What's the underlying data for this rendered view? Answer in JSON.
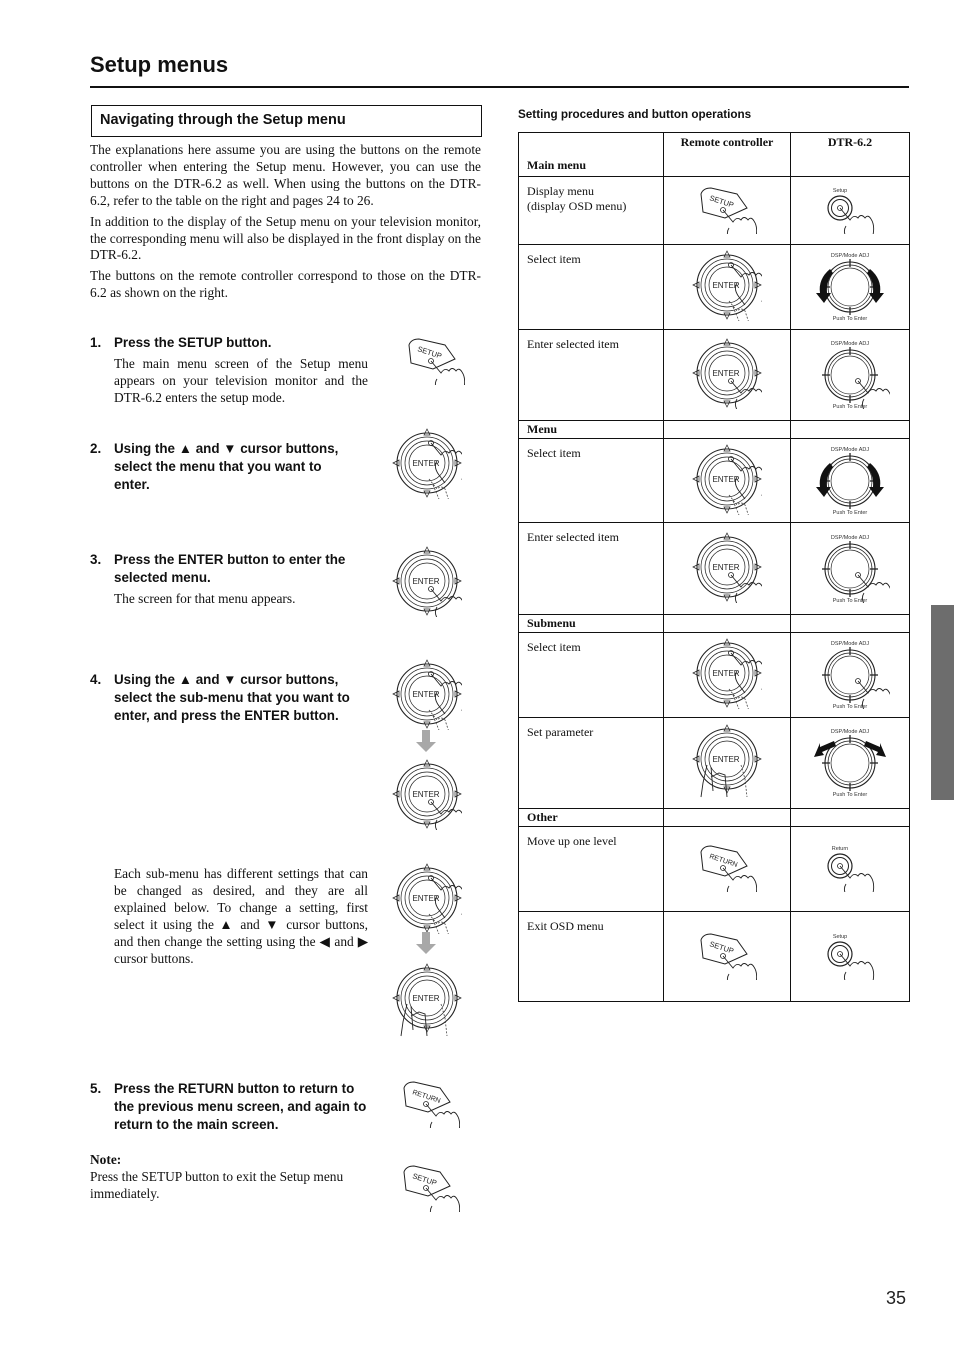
{
  "page": {
    "title": "Setup menus",
    "page_number": "35",
    "side_tab_color": "#6d6d6d"
  },
  "section": {
    "heading": "Navigating through the Setup menu",
    "intro": [
      "The explanations here assume you are using the buttons on the remote controller when entering the Setup menu. However, you can use the buttons on the DTR-6.2 as well. When using the buttons on the DTR-6.2, refer to the table on the right and pages 24 to 26.",
      "In addition to the display of the Setup menu on your television monitor, the corresponding menu will also be displayed in the front display on the DTR-6.2.",
      "The buttons on the remote controller correspond to those on the DTR-6.2 as shown on the right."
    ]
  },
  "steps": [
    {
      "num": "1.",
      "heading": "Press the SETUP button.",
      "body": "The main menu screen of the Setup menu appears on your television monitor and the DTR-6.2 enters the setup mode.",
      "icon": "setup-button-press"
    },
    {
      "num": "2.",
      "heading": "Using the ▲ and ▼ cursor buttons, select the menu that you want to enter.",
      "body": "",
      "icon": "enter-dial-up-down"
    },
    {
      "num": "3.",
      "heading": "Press the ENTER button to enter the selected menu.",
      "body": "The screen for that menu appears.",
      "icon": "enter-dial-press"
    },
    {
      "num": "4.",
      "heading": "Using the ▲ and ▼ cursor buttons, select the sub-menu that you want to enter, and press the ENTER button.",
      "body": "",
      "icon": "enter-dial-up-down-then-press"
    },
    {
      "num": "",
      "heading": "",
      "body": "Each sub-menu has different settings that can be changed as desired, and they are all explained below. To change a setting, first select it using the ▲ and ▼ cursor buttons, and then change the setting using the ◀ and ▶ cursor buttons.",
      "icon": "enter-dial-up-down-then-left-right"
    },
    {
      "num": "5.",
      "heading": "Press the RETURN button to return to the previous menu screen, and again to return to the main screen.",
      "body": "",
      "icon": "return-button-press"
    }
  ],
  "note": {
    "label": "Note:",
    "text": "Press the SETUP button to exit the Setup menu immediately.",
    "icon": "setup-button-press"
  },
  "table": {
    "title": "Setting procedures and button operations",
    "headers": {
      "col1": "Main menu",
      "col2": "Remote controller",
      "col3": "DTR-6.2"
    },
    "sections": [
      {
        "name": "Main menu",
        "rows": [
          {
            "label": "Display menu\n (display OSD menu)",
            "remote": "SETUP",
            "unit": "Setup"
          },
          {
            "label": "Select item",
            "remote": "ENTER",
            "unit": "DSP/Mode ADJ",
            "unit_bottom": "Push To Enter"
          },
          {
            "label": "Enter selected item",
            "remote": "ENTER",
            "unit": "DSP/Mode ADJ",
            "unit_bottom": "Push To Enter"
          }
        ]
      },
      {
        "name": "Menu",
        "rows": [
          {
            "label": "Select item",
            "remote": "ENTER",
            "unit": "DSP/Mode ADJ",
            "unit_bottom": "Push To Enter"
          },
          {
            "label": "Enter selected item",
            "remote": "ENTER",
            "unit": "DSP/Mode ADJ",
            "unit_bottom": "Push To Enter"
          }
        ]
      },
      {
        "name": "Submenu",
        "rows": [
          {
            "label": "Select item",
            "remote": "ENTER",
            "unit": "DSP/Mode ADJ",
            "unit_bottom": "Push To Enter"
          },
          {
            "label": "Set parameter",
            "remote": "ENTER",
            "unit": "DSP/Mode ADJ",
            "unit_bottom": "Push To Enter"
          }
        ]
      },
      {
        "name": "Other",
        "rows": [
          {
            "label": "Move up one level",
            "remote": "RETURN",
            "unit": "Return"
          },
          {
            "label": "Exit OSD menu",
            "remote": "SETUP",
            "unit": "Setup"
          }
        ]
      }
    ]
  }
}
